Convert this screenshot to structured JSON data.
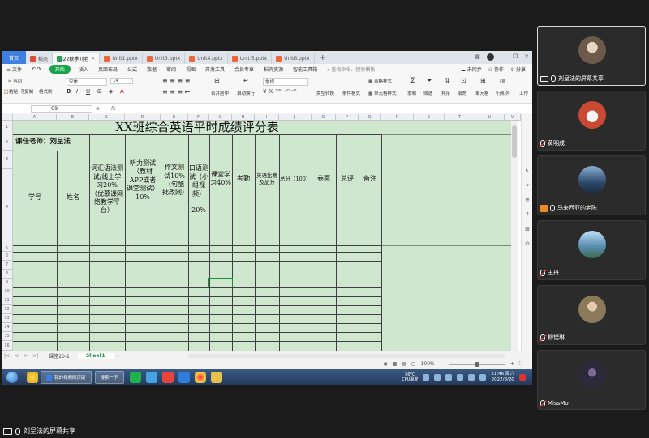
{
  "browser_tabs": [
    {
      "label": "首页",
      "kind": "home"
    },
    {
      "label": "稻壳",
      "kind": "red"
    },
    {
      "label": "2022秋季刘老",
      "kind": "green",
      "active": true
    },
    {
      "label": "Unit1.pptx",
      "kind": "orange"
    },
    {
      "label": "Unit3.pptx",
      "kind": "orange"
    },
    {
      "label": "Unit4.pptx",
      "kind": "orange"
    },
    {
      "label": "Unit 5.pptx",
      "kind": "orange"
    },
    {
      "label": "Unit6.pptx",
      "kind": "orange"
    }
  ],
  "menu": {
    "file": "文件",
    "items": [
      "开始",
      "插入",
      "页面布局",
      "公式",
      "数据",
      "审阅",
      "视图",
      "开发工具",
      "会员专享",
      "稻壳资源",
      "智能工具箱"
    ],
    "search": "查找命令、搜索模板",
    "unsynced": "未同步",
    "collab": "协作",
    "share": "分享"
  },
  "toolbar": {
    "cut": "剪切",
    "paste": "粘贴",
    "copy": "复制",
    "format_painter": "格式刷",
    "font_name": "宋体",
    "font_size": "14",
    "merge": "合并居中",
    "wrap": "自动换行",
    "number_format": "常规",
    "type_convert": "类型转换",
    "cond_format": "条件格式",
    "table_style": "表格样式",
    "cell_style": "单元格样式",
    "sum": "求和",
    "filter": "筛选",
    "sort": "排序",
    "fill": "填充",
    "cell": "单元格",
    "row_col": "行和列",
    "worksheet": "工作"
  },
  "formula_bar": {
    "cell_ref": "C9",
    "fx": "fx"
  },
  "sheet": {
    "columns": [
      "A",
      "B",
      "C",
      "D",
      "E",
      "F",
      "G",
      "H",
      "I",
      "J",
      "K",
      "L",
      "M",
      "N",
      "R",
      "S",
      "T",
      "U",
      "V"
    ],
    "column_labels_visible": [
      "A",
      "B",
      "C",
      "D",
      "E",
      "F",
      "G",
      "H",
      "I",
      "J",
      "O",
      "P",
      "Q",
      "R",
      "S",
      "T",
      "U",
      "V"
    ],
    "rows": [
      "1",
      "2",
      "3",
      "4",
      "5",
      "6",
      "7",
      "8",
      "9",
      "10",
      "11",
      "12",
      "13",
      "14",
      "15",
      "16"
    ],
    "title": "XX班综合英语平时成绩评分表",
    "teacher": "课任老师：刘呈法",
    "headers": {
      "student_no": "学号",
      "name": "姓名",
      "vocab": "词汇语法测试/线上学习20%（优慕课网络教学平台）",
      "listening": "听力测试（教材APP或者课堂测试）10%",
      "writing": "作文测试10%（句酷批改网）",
      "oral": "口语测试（小组视频）\n\n20%",
      "class_learning": "课堂学习40%",
      "attendance": "考勤",
      "contest": "英语比赛及加分",
      "total": "总分（100）",
      "paper": "卷面",
      "final": "总评",
      "note": "备注"
    }
  },
  "sheet_tabs": {
    "tab1": "课堂20-1",
    "tab2": "Sheet1",
    "add": "+"
  },
  "status": {
    "zoom": "100%"
  },
  "taskbar": {
    "task1": "我的视频网页版",
    "task2": "搜索一下",
    "weather_temp": "56°C",
    "weather_label": "CPU温度",
    "time": "21:46 周六",
    "date": "2022/8/20"
  },
  "participants": [
    {
      "name": "刘呈法的屏幕共享",
      "type": "share",
      "avatar_color": "#6d5a4a"
    },
    {
      "name": "黄明成",
      "type": "mic-off",
      "avatar_color": "#c94a32"
    },
    {
      "name": "马来西亚的老陈",
      "type": "user",
      "avatar_color": "#2d4a6b"
    },
    {
      "name": "王丹",
      "type": "mic-off",
      "avatar_color": "#5a8fb5"
    },
    {
      "name": "柳韫琳",
      "type": "mic-off",
      "avatar_color": "#8a7a5a"
    },
    {
      "name": "MissMo",
      "type": "mic-off",
      "avatar_color": "#2a2a3a"
    }
  ],
  "bottom_label": "刘呈法的屏幕共享"
}
